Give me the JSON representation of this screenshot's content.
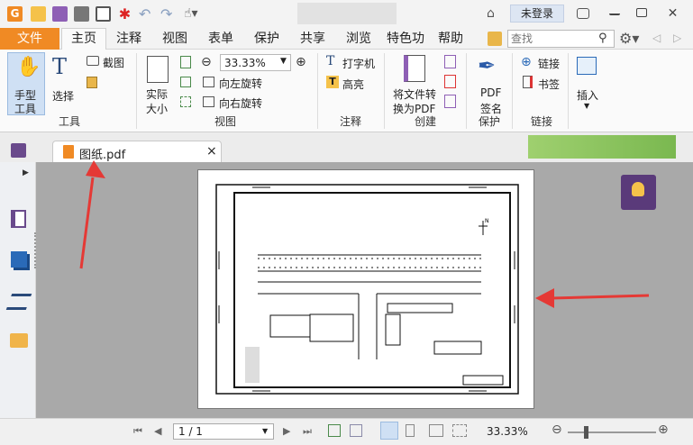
{
  "window": {
    "login_label": "未登录"
  },
  "menu": {
    "file": "文件",
    "items": [
      "主页",
      "注释",
      "视图",
      "表单",
      "保护",
      "共享",
      "浏览",
      "特色功",
      "帮助"
    ],
    "search_placeholder": "查找"
  },
  "ribbon": {
    "hand_tool": "手型工具",
    "hand_tool_l1": "手型",
    "hand_tool_l2": "工具",
    "select": "选择",
    "screenshot": "截图",
    "group_tools": "工具",
    "actual_size_l1": "实际",
    "actual_size_l2": "大小",
    "zoom_value": "33.33%",
    "rotate_left": "向左旋转",
    "rotate_right": "向右旋转",
    "group_view": "视图",
    "typewriter": "打字机",
    "highlight": "高亮",
    "group_comment": "注释",
    "convert_l1": "将文件转",
    "convert_l2": "换为PDF",
    "group_create": "创建",
    "pdf_sign_l1": "PDF",
    "pdf_sign_l2": "签名",
    "group_protect": "保护",
    "link": "链接",
    "bookmark": "书签",
    "group_link": "链接",
    "insert": "插入"
  },
  "tab": {
    "filename": "图纸.pdf",
    "close": "×"
  },
  "drawing": {
    "north": "N"
  },
  "status": {
    "page": "1 / 1",
    "zoom": "33.33%"
  },
  "colors": {
    "accent_orange": "#f08a24",
    "brand_purple": "#6a4a8c",
    "annotation_red": "#e53935"
  }
}
